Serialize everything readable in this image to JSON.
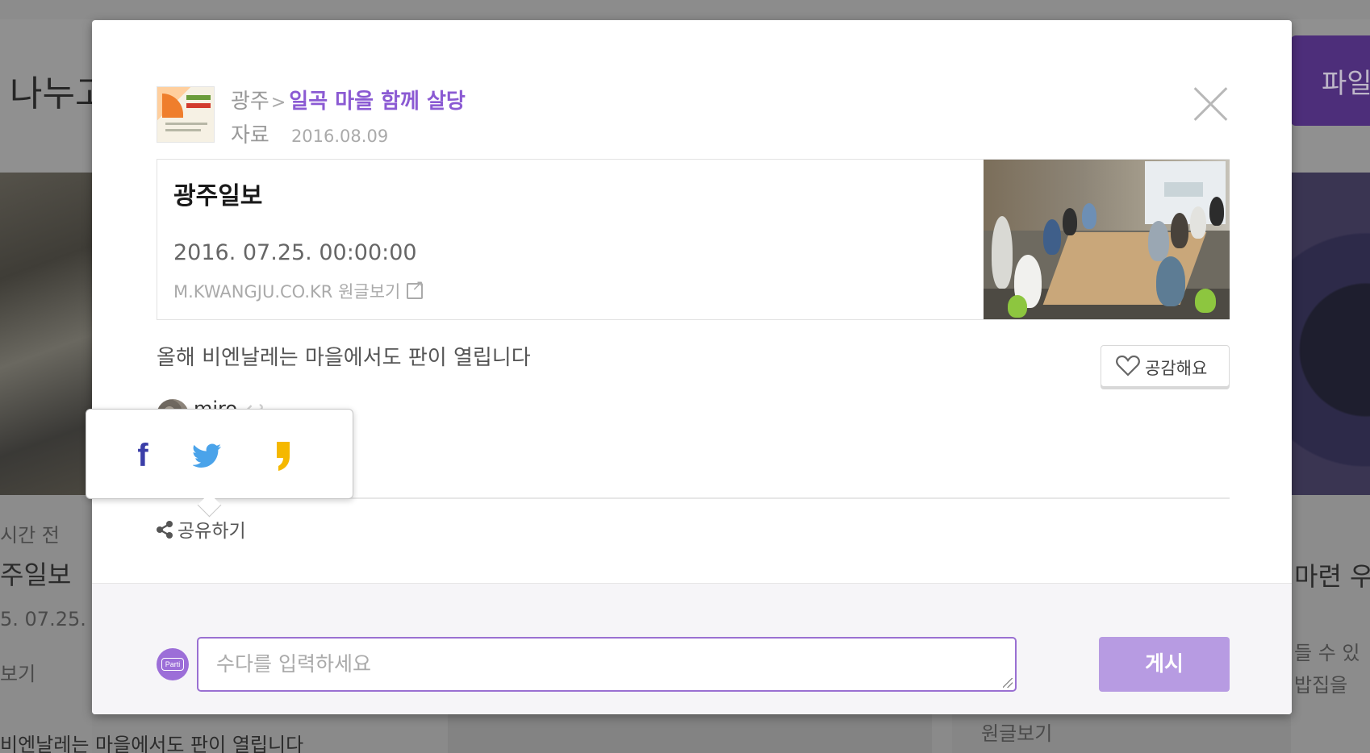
{
  "background": {
    "page_title_fragment": "나누고",
    "file_button_fragment": "파일",
    "left_card": {
      "time": "시간 전",
      "title": "주일보",
      "date": "5. 07.25. 0",
      "link": "보기"
    },
    "right_card": {
      "title": "마련 우",
      "line1": "들 수 있",
      "line2": "밥집을"
    },
    "bottom_left_text": "비엔날레는 마을에서도 판이 열립니다",
    "bottom_right_link": "원글보기"
  },
  "modal": {
    "breadcrumb": {
      "parent": "광주",
      "separator": ">",
      "group": "일곡 마을 함께 살당"
    },
    "post_type": "자료",
    "post_date": "2016.08.09",
    "link_card": {
      "title": "광주일보",
      "date": "2016. 07.25. 00:00:00",
      "source": "M.KWANGJU.CO.KR 원글보기"
    },
    "description": "올해 비엔날레는 마을에서도 판이 열립니다",
    "like_label": "공감해요",
    "author": "miro",
    "share_label": "공유하기",
    "share_targets": [
      "facebook-icon",
      "twitter-icon",
      "kakaostory-icon"
    ],
    "footer": {
      "avatar_text": "Parti",
      "comment_placeholder": "수다를 입력하세요",
      "post_label": "게시"
    }
  },
  "colors": {
    "accent": "#8b5ad3",
    "post_button": "#b79be2",
    "facebook": "#3b3ea8",
    "twitter": "#4aa3ea",
    "kakao": "#f5b800"
  }
}
